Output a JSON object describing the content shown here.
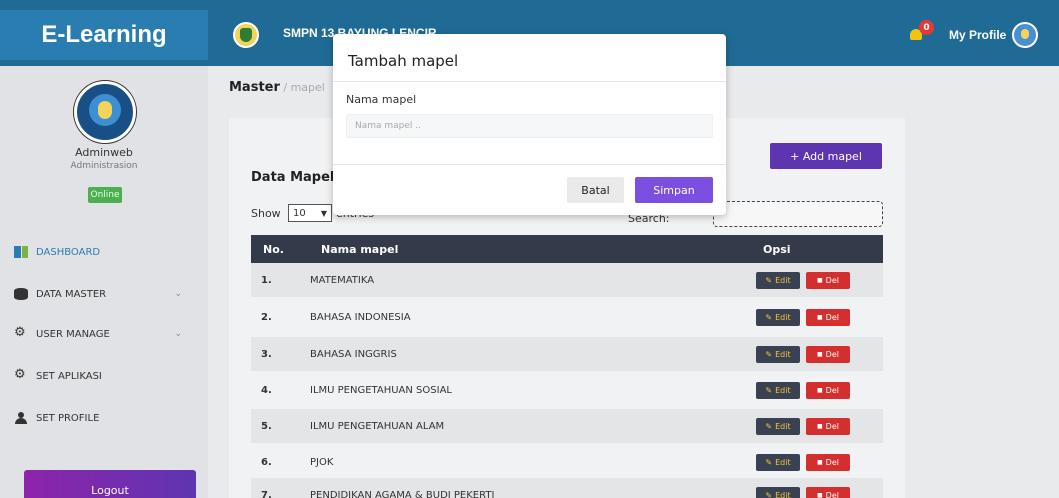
{
  "header": {
    "brand": "E-Learning",
    "school_name": "SMPN 13 BAYUNG LENCIR",
    "notification_count": "0",
    "profile_label": "My Profile"
  },
  "sidebar": {
    "user_name": "Adminweb",
    "user_role": "Administrasion",
    "status": "Online",
    "items": [
      {
        "label": "DASHBOARD",
        "icon": "dashboard-icon"
      },
      {
        "label": "DATA MASTER",
        "icon": "database-icon"
      },
      {
        "label": "USER MANAGE",
        "icon": "gear-icon"
      },
      {
        "label": "SET APLIKASI",
        "icon": "gears-icon"
      },
      {
        "label": "SET PROFILE",
        "icon": "user-icon"
      }
    ],
    "logout_label": "Logout"
  },
  "breadcrumb": {
    "main": "Master",
    "separator": " / ",
    "sub": "mapel"
  },
  "card": {
    "title": "Data Mapel",
    "add_button": "+ Add mapel",
    "show_label": "Show",
    "show_value": "10",
    "entries_label": "entries",
    "search_label": "Search:"
  },
  "table": {
    "headers": [
      "No.",
      "Nama mapel",
      "Opsi"
    ],
    "edit_label": "Edit",
    "del_label": "Del",
    "rows": [
      {
        "no": "1.",
        "name": "MATEMATIKA"
      },
      {
        "no": "2.",
        "name": "BAHASA INDONESIA"
      },
      {
        "no": "3.",
        "name": "BAHASA INGGRIS"
      },
      {
        "no": "4.",
        "name": "ILMU PENGETAHUAN SOSIAL"
      },
      {
        "no": "5.",
        "name": "ILMU PENGETAHUAN ALAM"
      },
      {
        "no": "6.",
        "name": "PJOK"
      },
      {
        "no": "7.",
        "name": "PENDIDIKAN AGAMA & BUDI PEKERTI"
      }
    ]
  },
  "modal": {
    "title": "Tambah mapel",
    "field_label": "Nama mapel",
    "field_placeholder": "Nama mapel ..",
    "cancel_label": "Batal",
    "save_label": "Simpan"
  },
  "colors": {
    "topbar": "#1f6b96",
    "brand_bg": "#2a7db0",
    "primary_button": "#5e35b1",
    "save_button": "#7b4fe0",
    "delete_button": "#d32f2f",
    "table_header": "#333b4b"
  }
}
